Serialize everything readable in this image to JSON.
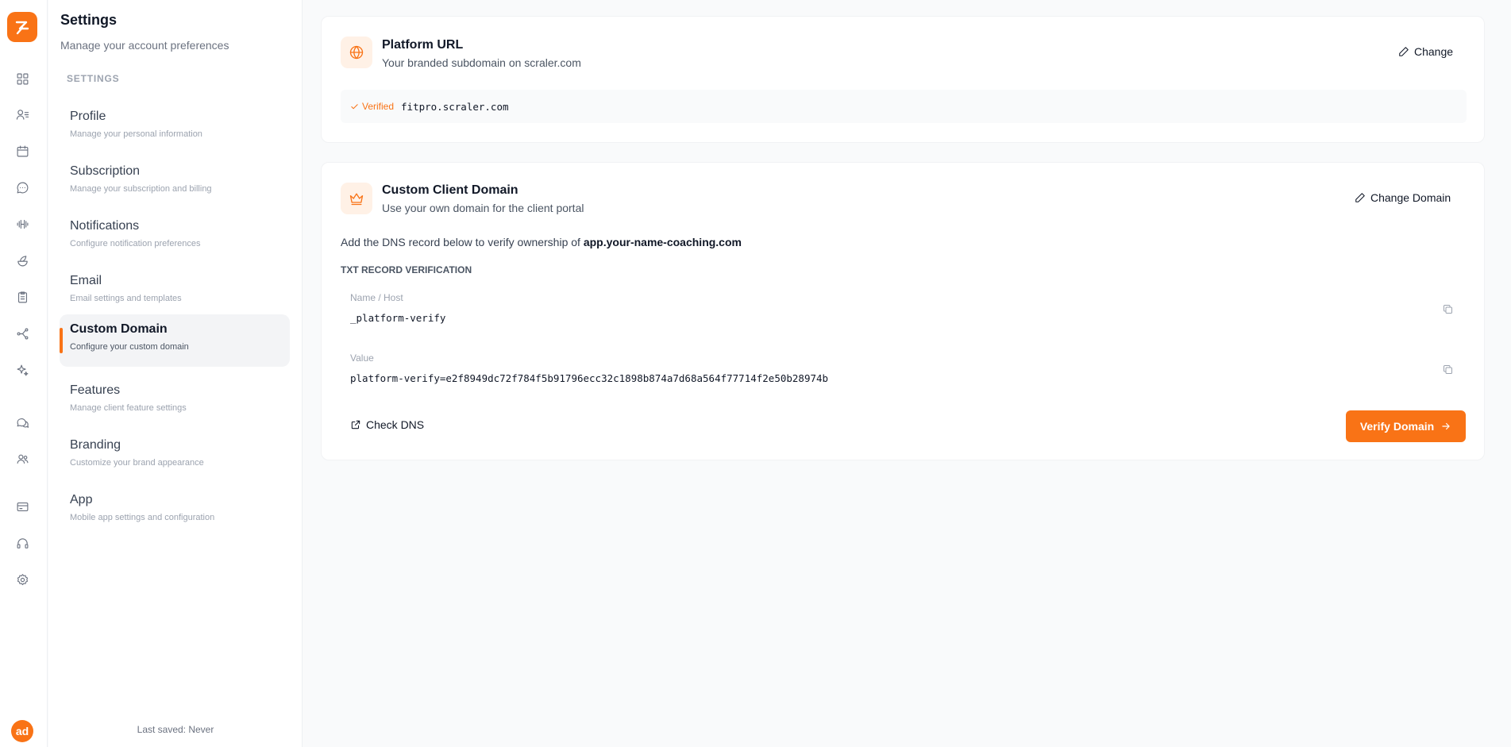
{
  "app": {
    "avatar_initials": "ad",
    "accent_color": "#f97316"
  },
  "rail": {
    "icons": [
      "dashboard-icon",
      "clients-icon",
      "calendar-icon",
      "chat-icon",
      "workouts-icon",
      "nutrition-icon",
      "forms-icon",
      "automations-icon",
      "ai-icon",
      "community-icon",
      "team-icon",
      "billing-icon",
      "support-icon",
      "settings-icon"
    ]
  },
  "sidebar": {
    "title": "Settings",
    "subtitle": "Manage your account preferences",
    "section_label": "SETTINGS",
    "items": [
      {
        "label": "Profile",
        "desc": "Manage your personal information"
      },
      {
        "label": "Subscription",
        "desc": "Manage your subscription and billing"
      },
      {
        "label": "Notifications",
        "desc": "Configure notification preferences"
      },
      {
        "label": "Email",
        "desc": "Email settings and templates"
      },
      {
        "label": "Custom Domain",
        "desc": "Configure your custom domain"
      },
      {
        "label": "Features",
        "desc": "Manage client feature settings"
      },
      {
        "label": "Branding",
        "desc": "Customize your brand appearance"
      },
      {
        "label": "App",
        "desc": "Mobile app settings and configuration"
      }
    ],
    "active_item": "Custom Domain",
    "last_saved": "Last saved: Never"
  },
  "platform_url": {
    "title": "Platform URL",
    "subtitle": "Your branded subdomain on scraler.com",
    "change_label": "Change",
    "status": "Verified",
    "domain": "fitpro.scraler.com"
  },
  "custom_domain": {
    "title": "Custom Client Domain",
    "subtitle": "Use your own domain for the client portal",
    "change_label": "Change Domain",
    "instruction": "Add the DNS record below to verify ownership of",
    "target_domain": "app.your-name-coaching.com",
    "record_type_label": "TXT RECORD VERIFICATION",
    "name_label": "Name / Host",
    "name_value": "_platform-verify",
    "value_label": "Value",
    "value_value": "platform-verify=e2f8949dc72f784f5b91796ecc32c1898b874a7d68a564f77714f2e50b28974b",
    "check_dns_label": "Check DNS",
    "verify_label": "Verify Domain"
  }
}
